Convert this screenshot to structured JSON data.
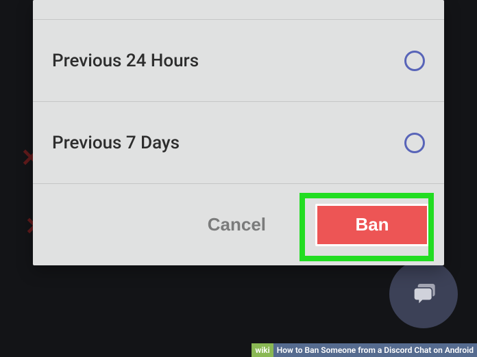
{
  "options": {
    "option1": {
      "label": "Previous 24 Hours"
    },
    "option2": {
      "label": "Previous 7 Days"
    }
  },
  "buttons": {
    "cancel": "Cancel",
    "ban": "Ban"
  },
  "caption": {
    "prefix": "wiki",
    "text": "How to Ban Someone from a Discord Chat on Android"
  },
  "colors": {
    "accent": "#5864b8",
    "danger": "#ed5555",
    "highlight": "#22dd22"
  }
}
